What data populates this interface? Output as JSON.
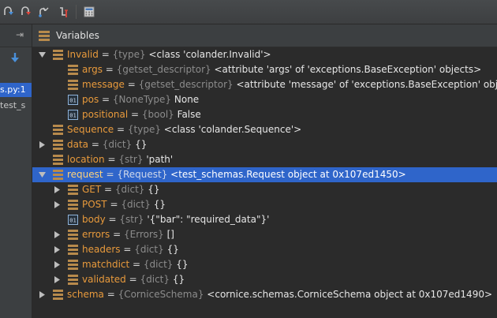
{
  "toolbar": {
    "buttons": [
      "step-into-icon",
      "force-step-into-icon",
      "step-out-icon",
      "run-to-cursor-icon",
      "evaluate-expression-icon"
    ]
  },
  "left_panel": {
    "rows": [
      {
        "text": "s.py:1",
        "selected": true
      },
      {
        "text": "test_s",
        "selected": false
      }
    ]
  },
  "variables": {
    "title": "Variables",
    "rows": [
      {
        "depth": 0,
        "arrow": "down",
        "icon": "field",
        "name": "Invalid",
        "type": "{type}",
        "value": "<class 'colander.Invalid'>"
      },
      {
        "depth": 1,
        "arrow": "none",
        "icon": "field",
        "name": "args",
        "type": "{getset_descriptor}",
        "value": "<attribute 'args' of 'exceptions.BaseException' objects>"
      },
      {
        "depth": 1,
        "arrow": "none",
        "icon": "field",
        "name": "message",
        "type": "{getset_descriptor}",
        "value": "<attribute 'message' of 'exceptions.BaseException' objects>"
      },
      {
        "depth": 1,
        "arrow": "none",
        "icon": "primitive",
        "name": "pos",
        "type": "{NoneType}",
        "value": "None"
      },
      {
        "depth": 1,
        "arrow": "none",
        "icon": "primitive",
        "name": "positional",
        "type": "{bool}",
        "value": "False"
      },
      {
        "depth": 0,
        "arrow": "none",
        "icon": "field",
        "name": "Sequence",
        "type": "{type}",
        "value": "<class 'colander.Sequence'>"
      },
      {
        "depth": 0,
        "arrow": "right",
        "icon": "field",
        "name": "data",
        "type": "{dict}",
        "value": "{}"
      },
      {
        "depth": 0,
        "arrow": "none",
        "icon": "field",
        "name": "location",
        "type": "{str}",
        "value": "'path'"
      },
      {
        "depth": 0,
        "arrow": "down",
        "icon": "field",
        "name": "request",
        "type": "{Request}",
        "value": "<test_schemas.Request object at 0x107ed1450>",
        "selected": true
      },
      {
        "depth": 1,
        "arrow": "right",
        "icon": "field",
        "name": "GET",
        "type": "{dict}",
        "value": "{}"
      },
      {
        "depth": 1,
        "arrow": "right",
        "icon": "field",
        "name": "POST",
        "type": "{dict}",
        "value": "{}"
      },
      {
        "depth": 1,
        "arrow": "none",
        "icon": "primitive",
        "name": "body",
        "type": "{str}",
        "value": "'{\"bar\": \"required_data\"}'"
      },
      {
        "depth": 1,
        "arrow": "right",
        "icon": "field",
        "name": "errors",
        "type": "{Errors}",
        "value": "[]"
      },
      {
        "depth": 1,
        "arrow": "right",
        "icon": "field",
        "name": "headers",
        "type": "{dict}",
        "value": "{}"
      },
      {
        "depth": 1,
        "arrow": "right",
        "icon": "field",
        "name": "matchdict",
        "type": "{dict}",
        "value": "{}"
      },
      {
        "depth": 1,
        "arrow": "right",
        "icon": "field",
        "name": "validated",
        "type": "{dict}",
        "value": "{}"
      },
      {
        "depth": 0,
        "arrow": "right",
        "icon": "field",
        "name": "schema",
        "type": "{CorniceSchema}",
        "value": "<cornice.schemas.CorniceSchema object at 0x107ed1490>"
      }
    ]
  }
}
